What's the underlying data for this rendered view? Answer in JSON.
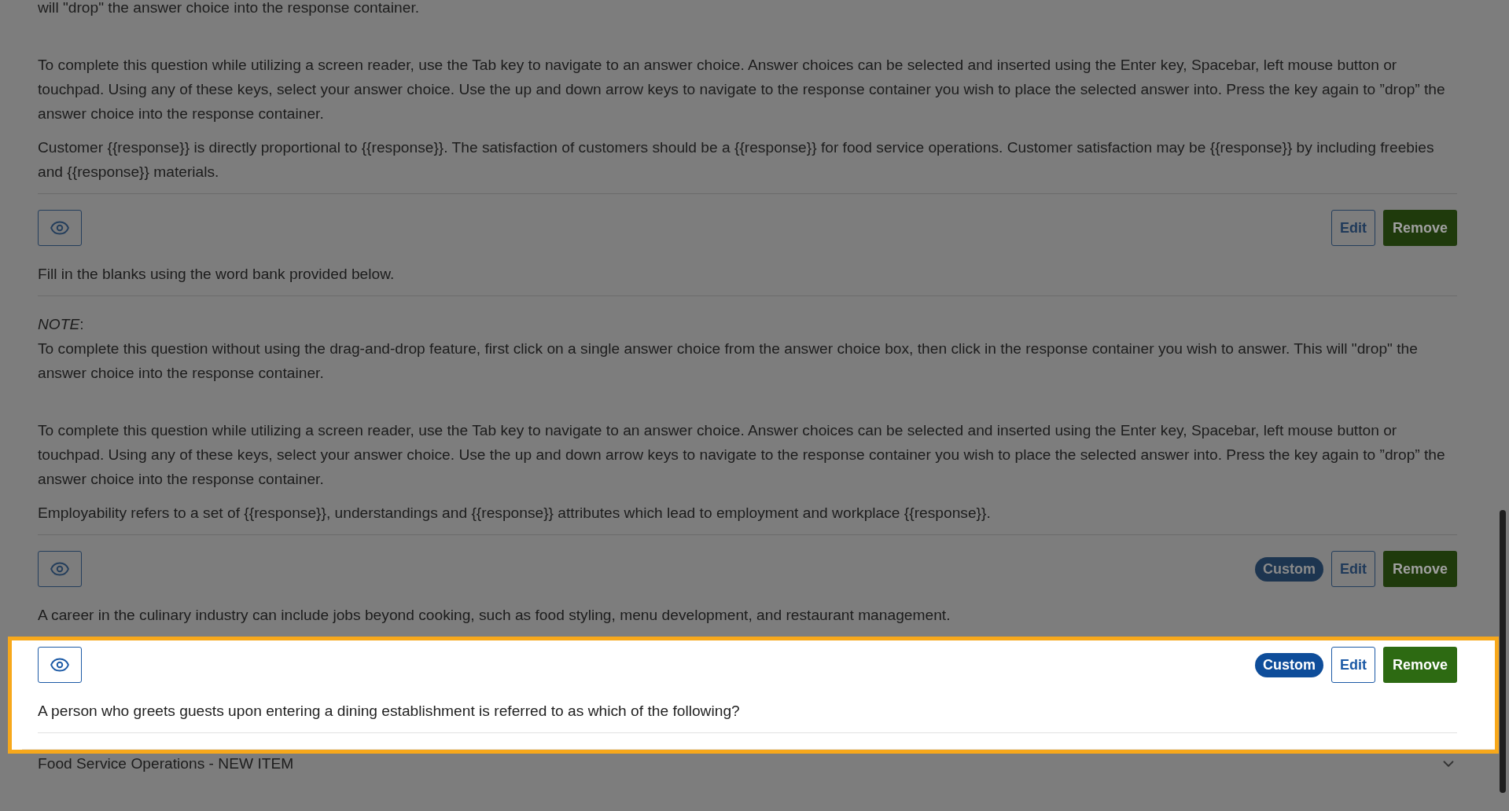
{
  "sections": [
    {
      "highlighted": false,
      "blocks": [
        {
          "kind": "paragraph",
          "text": "will \"drop\" the answer choice into the response container."
        },
        {
          "kind": "blank"
        },
        {
          "kind": "paragraph",
          "text": "To complete this question while utilizing a screen reader, use the Tab key to navigate to an answer choice. Answer choices can be selected and inserted using the Enter key, Spacebar, left mouse button or touchpad. Using any of these keys, select your answer choice. Use the up and down arrow keys to navigate to the response container you wish to place the selected answer into. Press the key again to ”drop” the answer choice into the response container."
        },
        {
          "kind": "paragraph",
          "text": "Customer {{response}} is directly proportional to {{response}}. The satisfaction of customers should be a {{response}} for food service operations. Customer satisfaction may be {{response}} by including freebies and {{response}} materials."
        },
        {
          "kind": "divider"
        },
        {
          "kind": "toolbar",
          "edit": "Edit",
          "remove": "Remove"
        },
        {
          "kind": "paragraph",
          "text": "Fill in the blanks using the word bank provided below."
        },
        {
          "kind": "divider"
        },
        {
          "kind": "note",
          "label": "*NOTE*:",
          "text": "To complete this question without using the drag-and-drop feature, first click on a single answer choice from the answer choice box, then click in the response container you wish to answer. This will \"drop\" the answer choice into the response container."
        },
        {
          "kind": "blank"
        },
        {
          "kind": "paragraph",
          "text": "To complete this question while utilizing a screen reader, use the Tab key to navigate to an answer choice. Answer choices can be selected and inserted using the Enter key, Spacebar, left mouse button or touchpad. Using any of these keys, select your answer choice. Use the up and down arrow keys to navigate to the response container you wish to place the selected answer into. Press the key again to ”drop” the answer choice into the response container."
        },
        {
          "kind": "paragraph",
          "text": "Employability refers to a set of {{response}}, understandings and {{response}} attributes which lead to employment and workplace {{response}}."
        },
        {
          "kind": "divider"
        },
        {
          "kind": "toolbar",
          "badge": "Custom",
          "edit": "Edit",
          "remove": "Remove"
        },
        {
          "kind": "paragraph",
          "text": "A career in the culinary industry can include jobs beyond cooking, such as food styling, menu development, and restaurant management."
        }
      ]
    },
    {
      "highlighted": true,
      "blocks": [
        {
          "kind": "toolbar",
          "badge": "Custom",
          "edit": "Edit",
          "remove": "Remove"
        },
        {
          "kind": "paragraph",
          "text": "A person who greets guests upon entering a dining establishment is referred to as which of the following?"
        },
        {
          "kind": "divider"
        }
      ]
    },
    {
      "highlighted": false,
      "blocks": [
        {
          "kind": "heading",
          "text": "Food Service Operations - NEW ITEM"
        }
      ]
    }
  ]
}
